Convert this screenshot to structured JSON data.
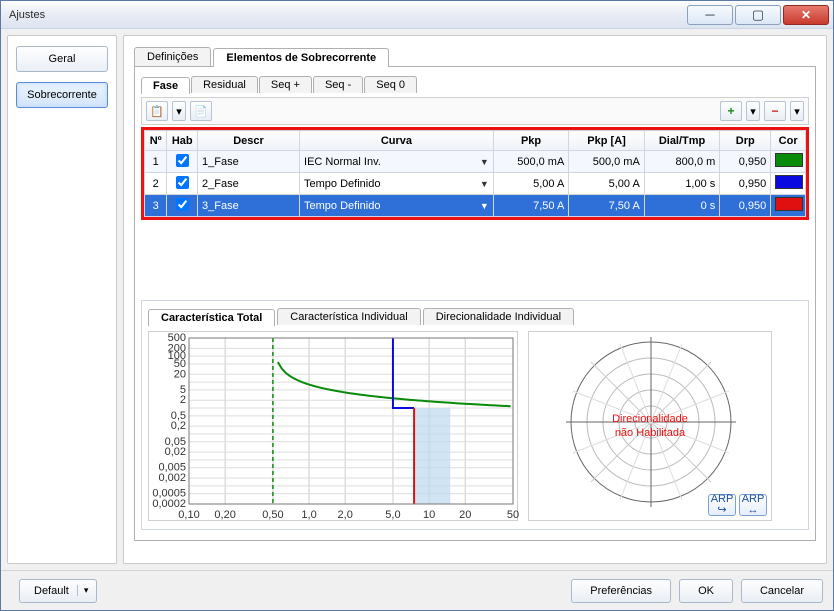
{
  "window": {
    "title": "Ajustes"
  },
  "sidebar": {
    "geral": "Geral",
    "sobrecorrente": "Sobrecorrente"
  },
  "tabs1": {
    "definicoes": "Definições",
    "elementos": "Elementos de Sobrecorrente"
  },
  "tabs2": {
    "fase": "Fase",
    "residual": "Residual",
    "seqp": "Seq +",
    "seqm": "Seq -",
    "seq0": "Seq 0"
  },
  "table": {
    "headers": {
      "n": "Nº",
      "hab": "Hab",
      "descr": "Descr",
      "curva": "Curva",
      "pkp": "Pkp",
      "pkpa": "Pkp [A]",
      "dial": "Dial/Tmp",
      "drp": "Drp",
      "cor": "Cor"
    },
    "rows": [
      {
        "n": "1",
        "hab": true,
        "descr": "1_Fase",
        "curva": "IEC Normal Inv.",
        "pkp": "500,0 mA",
        "pkpa": "500,0 mA",
        "dial": "800,0 m",
        "drp": "0,950",
        "cor": "#0a8a0a"
      },
      {
        "n": "2",
        "hab": true,
        "descr": "2_Fase",
        "curva": "Tempo Definido",
        "pkp": "5,00 A",
        "pkpa": "5,00 A",
        "dial": "1,00 s",
        "drp": "0,950",
        "cor": "#0a0ae0"
      },
      {
        "n": "3",
        "hab": true,
        "descr": "3_Fase",
        "curva": "Tempo Definido",
        "pkp": "7,50 A",
        "pkpa": "7,50 A",
        "dial": "0 s",
        "drp": "0,950",
        "cor": "#e01010"
      }
    ]
  },
  "tabs3": {
    "total": "Característica Total",
    "indiv": "Característica Individual",
    "dir": "Direcionalidade Individual"
  },
  "dir_text": {
    "l1": "Direcionalidade",
    "l2": "não Habilitada"
  },
  "arp": "ARP",
  "footer": {
    "default": "Default",
    "pref": "Preferências",
    "ok": "OK",
    "cancel": "Cancelar"
  },
  "chart_data": {
    "type": "line",
    "title": "",
    "xlabel": "",
    "ylabel": "",
    "x_ticks": [
      "0,10",
      "0,20",
      "0,50",
      "1,0",
      "2,0",
      "5,0",
      "10",
      "20",
      "50"
    ],
    "y_ticks": [
      "0,0002",
      "0,0005",
      "0,002",
      "0,005",
      "0,02",
      "0,05",
      "0,20",
      "0,50",
      "2,0",
      "5,0",
      "20",
      "50",
      "100",
      "200",
      "500"
    ],
    "x_scale": "log",
    "y_scale": "log",
    "xlim": [
      0.1,
      50
    ],
    "ylim": [
      0.0002,
      500
    ],
    "series": [
      {
        "name": "1_Fase",
        "color": "#0a8a0a",
        "curve": "IEC Normal Inv.",
        "pickup_A": 0.5,
        "dial": 0.8
      },
      {
        "name": "2_Fase",
        "color": "#0a0ae0",
        "curve": "Tempo Definido",
        "pickup_A": 5.0,
        "time_s": 1.0
      },
      {
        "name": "3_Fase",
        "color": "#e01010",
        "curve": "Tempo Definido",
        "pickup_A": 7.5,
        "time_s": 0.0
      }
    ]
  }
}
